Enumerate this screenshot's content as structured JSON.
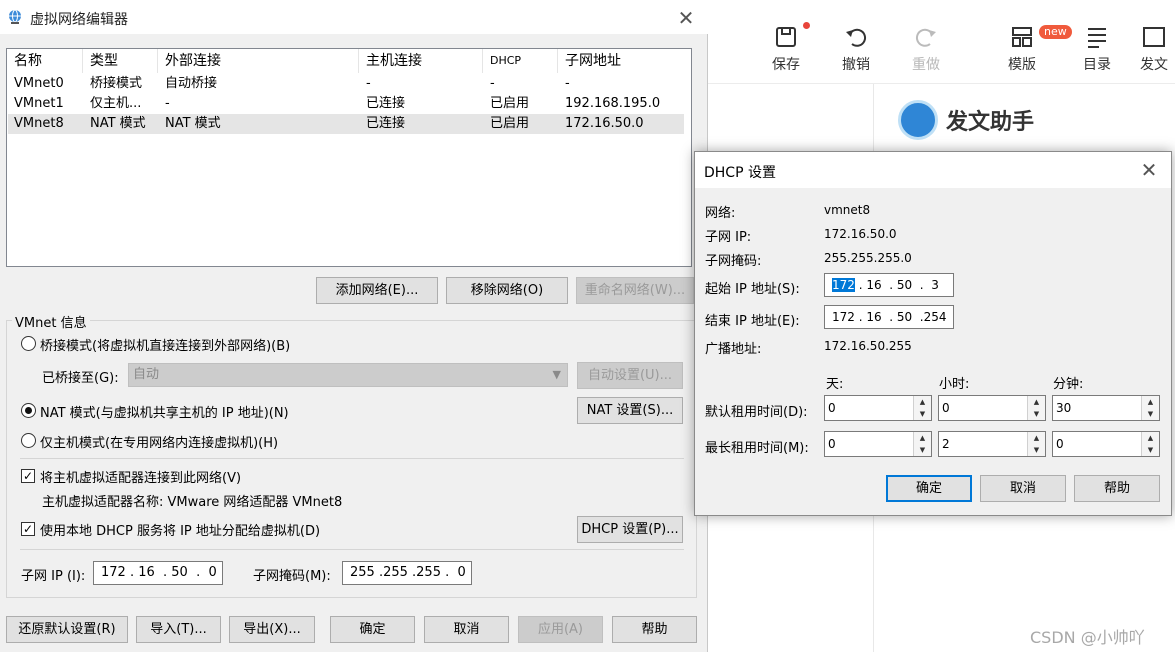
{
  "main_window": {
    "title": "虚拟网络编辑器",
    "list_headers": [
      "名称",
      "类型",
      "外部连接",
      "主机连接",
      "DHCP",
      "子网地址"
    ],
    "rows": [
      {
        "name": "VMnet0",
        "type": "桥接模式",
        "external": "自动桥接",
        "host": "-",
        "dhcp": "-",
        "subnet": "-"
      },
      {
        "name": "VMnet1",
        "type": "仅主机...",
        "external": "-",
        "host": "已连接",
        "dhcp": "已启用",
        "subnet": "192.168.195.0"
      },
      {
        "name": "VMnet8",
        "type": "NAT 模式",
        "external": "NAT 模式",
        "host": "已连接",
        "dhcp": "已启用",
        "subnet": "172.16.50.0"
      }
    ],
    "add_network_label": "添加网络(E)...",
    "remove_network_label": "移除网络(O)",
    "rename_network_label": "重命名网络(W)...",
    "vmnet_info_label": "VMnet 信息",
    "bridged_label": "桥接模式(将虚拟机直接连接到外部网络)(B)",
    "bridged_to_label": "已桥接至(G):",
    "bridged_to_value": "自动",
    "auto_settings_label": "自动设置(U)...",
    "nat_label": "NAT 模式(与虚拟机共享主机的 IP 地址)(N)",
    "nat_settings_label": "NAT 设置(S)...",
    "host_only_label": "仅主机模式(在专用网络内连接虚拟机)(H)",
    "connect_adapter_label": "将主机虚拟适配器连接到此网络(V)",
    "adapter_name_label": "主机虚拟适配器名称: VMware 网络适配器 VMnet8",
    "use_dhcp_label": "使用本地 DHCP 服务将 IP 地址分配给虚拟机(D)",
    "dhcp_settings_label": "DHCP 设置(P)...",
    "subnet_ip_label": "子网 IP (I):",
    "subnet_ip_value": "172 . 16  . 50  .  0",
    "subnet_mask_label": "子网掩码(M):",
    "subnet_mask_value": "255 .255 .255 .  0",
    "restore_defaults_label": "还原默认设置(R)",
    "import_label": "导入(T)...",
    "export_label": "导出(X)...",
    "ok_label": "确定",
    "cancel_label": "取消",
    "apply_label": "应用(A)",
    "help_label": "帮助"
  },
  "dhcp_dialog": {
    "title": "DHCP 设置",
    "network_label": "网络:",
    "network_value": "vmnet8",
    "subnet_ip_label": "子网 IP:",
    "subnet_ip_value": "172.16.50.0",
    "subnet_mask_label": "子网掩码:",
    "subnet_mask_value": "255.255.255.0",
    "start_ip_label": "起始 IP 地址(S):",
    "start_ip_selected": "172",
    "start_ip_rest": " . 16  . 50  .  3",
    "end_ip_label": "结束 IP 地址(E):",
    "end_ip_value": "172 . 16  . 50  .254",
    "broadcast_label": "广播地址:",
    "broadcast_value": "172.16.50.255",
    "col_days": "天:",
    "col_hours": "小时:",
    "col_minutes": "分钟:",
    "default_lease_label": "默认租用时间(D):",
    "default_lease": {
      "days": "0",
      "hours": "0",
      "minutes": "30"
    },
    "max_lease_label": "最长租用时间(M):",
    "max_lease": {
      "days": "0",
      "hours": "2",
      "minutes": "0"
    },
    "ok_label": "确定",
    "cancel_label": "取消",
    "help_label": "帮助"
  },
  "editor": {
    "toolbar": [
      {
        "label": "保存",
        "icon": "save-icon"
      },
      {
        "label": "撤销",
        "icon": "undo-icon"
      },
      {
        "label": "重做",
        "icon": "redo-icon",
        "disabled": true
      },
      {
        "label": "模版",
        "icon": "template-icon"
      },
      {
        "label": "目录",
        "icon": "toc-icon"
      },
      {
        "label": "发文",
        "icon": "publish-icon"
      }
    ],
    "new_badge": "new",
    "helper_title": "发文助手",
    "watermark": "CSDN @小帅吖"
  },
  "colors": {
    "focus_blue": "#0078d7",
    "dialog_bg": "#f0f0f0",
    "badge_red": "#f05a3c"
  }
}
